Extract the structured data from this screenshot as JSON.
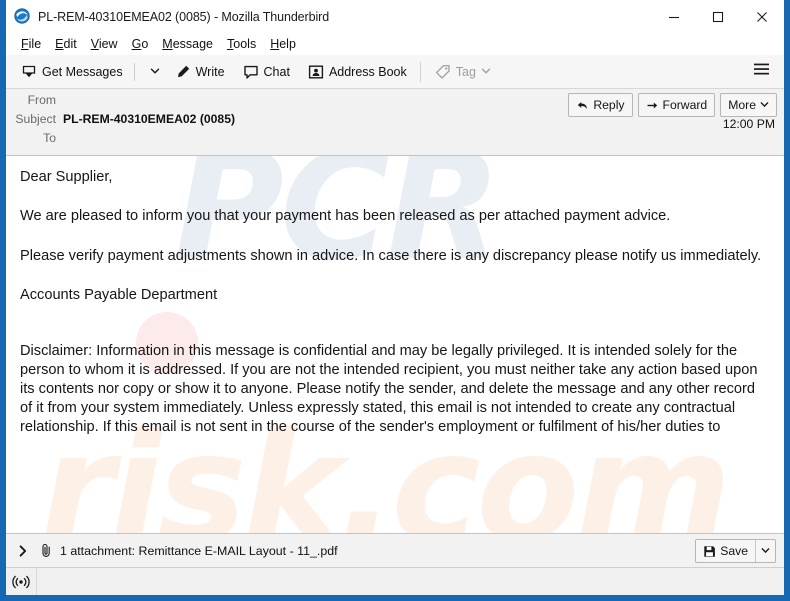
{
  "window": {
    "title": "PL-REM-40310EMEA02 (0085) - Mozilla Thunderbird",
    "app_icon": "thunderbird-icon",
    "controls": {
      "minimize": "minimize-icon",
      "maximize": "maximize-icon",
      "close": "close-icon"
    },
    "frame_color": "#1668b3"
  },
  "menubar": {
    "items": [
      {
        "label": "File",
        "accesskey": "F"
      },
      {
        "label": "Edit",
        "accesskey": "E"
      },
      {
        "label": "View",
        "accesskey": "V"
      },
      {
        "label": "Go",
        "accesskey": "G"
      },
      {
        "label": "Message",
        "accesskey": "M"
      },
      {
        "label": "Tools",
        "accesskey": "T"
      },
      {
        "label": "Help",
        "accesskey": "H"
      }
    ]
  },
  "toolbar": {
    "get_messages": "Get Messages",
    "get_messages_icon": "inbox-download-icon",
    "write": "Write",
    "write_icon": "pencil-icon",
    "chat": "Chat",
    "chat_icon": "speech-bubble-icon",
    "address_book": "Address Book",
    "address_book_icon": "contact-card-icon",
    "tag": "Tag",
    "tag_icon": "tag-icon",
    "tag_disabled": true,
    "app_menu_icon": "hamburger-menu-icon"
  },
  "message_header": {
    "from_label": "From",
    "from_value": "",
    "subject_label": "Subject",
    "subject_value": "PL-REM-40310EMEA02 (0085)",
    "to_label": "To",
    "to_value": "",
    "time": "12:00 PM",
    "actions": {
      "reply": "Reply",
      "reply_icon": "reply-arrow-icon",
      "forward": "Forward",
      "forward_icon": "forward-arrow-icon",
      "more": "More",
      "more_icon": "chevron-down-icon"
    }
  },
  "message_body": {
    "greeting": "Dear Supplier,",
    "paragraph1": "We are pleased to inform you that your payment has been released as per attached payment advice.",
    "paragraph2": "Please verify payment adjustments shown in advice. In case there is any discrepancy please notify us immediately.",
    "signature": "Accounts Payable Department",
    "disclaimer": "Disclaimer: Information in this message is confidential and may be legally privileged. It is intended solely for the person to whom it is addressed. If you are not the intended recipient, you must neither take any action based upon its contents nor copy or show it to anyone. Please notify the sender, and delete the message and any other record of it from your system immediately. Unless expressly stated, this email is not intended to create any contractual relationship. If this email is not sent in the course of the sender's employment or fulfilment of his/her duties to",
    "watermark_text_1": "PCR",
    "watermark_text_2": "risk.com"
  },
  "attachment_bar": {
    "expand_icon": "chevron-right-icon",
    "clip_icon": "paperclip-icon",
    "text": "1 attachment: Remittance E-MAIL Layout - 11_.pdf",
    "count": "1",
    "filename": "Remittance E-MAIL Layout - 11_.pdf",
    "save_label": "Save",
    "save_icon": "floppy-disk-icon",
    "save_dropdown_icon": "chevron-down-icon"
  },
  "statusbar": {
    "icon": "broadcast-antenna-icon"
  }
}
